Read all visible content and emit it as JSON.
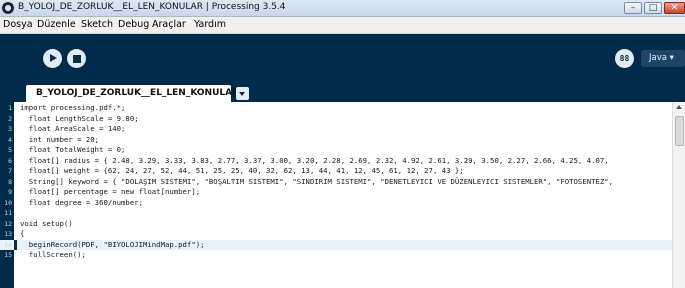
{
  "window": {
    "title": "B_YOLOJ_DE_ZORLUK__EL_LEN_KONULAR | Processing 3.5.4"
  },
  "menu": [
    "Dosya",
    "Düzenle",
    "Sketch",
    "Debug",
    "Araçlar",
    "Yardım"
  ],
  "toolbar": {
    "run_icon": "play-icon",
    "stop_icon": "stop-icon",
    "debugger_label": "88",
    "mode_label": "Java ▾"
  },
  "tab": {
    "label": "B_YOLOJ_DE_ZORLUK__EL_LEN_KONULAR"
  },
  "editor": {
    "active_line": 14,
    "lines": [
      {
        "n": "1",
        "code": "import processing.pdf.*;"
      },
      {
        "n": "2",
        "code": "  float LengthScale = 9.80;"
      },
      {
        "n": "3",
        "code": "  float AreaScale = 140;"
      },
      {
        "n": "4",
        "code": "  int number = 20;"
      },
      {
        "n": "5",
        "code": "  float TotalWeight = 0;"
      },
      {
        "n": "6",
        "code": "  float[] radius = { 2.48, 3.29, 3.33, 3.83, 2.77, 3.37, 3.00, 3.20, 2.28, 2.69, 2.32, 4.92, 2.61, 3.29, 3.50, 2.27, 2.66, 4.25, 4.07,"
      },
      {
        "n": "7",
        "code": "  float[] weight = {62, 24, 27, 52, 44, 51, 25, 25, 40, 32, 62, 13, 44, 41, 12, 45, 61, 12, 27, 43 };"
      },
      {
        "n": "8",
        "code": "  String[] keyword = { \"DOLAŞIM SISTEMI\", \"BOŞALTIM SISTEMI\", \"SINDIRIM SISTEMI\", \"DENETLEYICI VE DÜZENLEYICI SISTEMLER\", \"FOTOSENTEZ\","
      },
      {
        "n": "9",
        "code": "  float[] percentage = new float[number];"
      },
      {
        "n": "10",
        "code": "  float degree = 360/number;"
      },
      {
        "n": "11",
        "code": ""
      },
      {
        "n": "12",
        "code": "void setup()"
      },
      {
        "n": "13",
        "code": "{"
      },
      {
        "n": "14",
        "code": "  beginRecord(PDF, \"BIYOLOJIMindMap.pdf\");"
      },
      {
        "n": "15",
        "code": "  fullScreen();"
      }
    ]
  },
  "colors": {
    "toolbar_bg": "#002b4a",
    "editor_bg": "#ffffff",
    "active_line_bg": "#e8f2fb"
  }
}
